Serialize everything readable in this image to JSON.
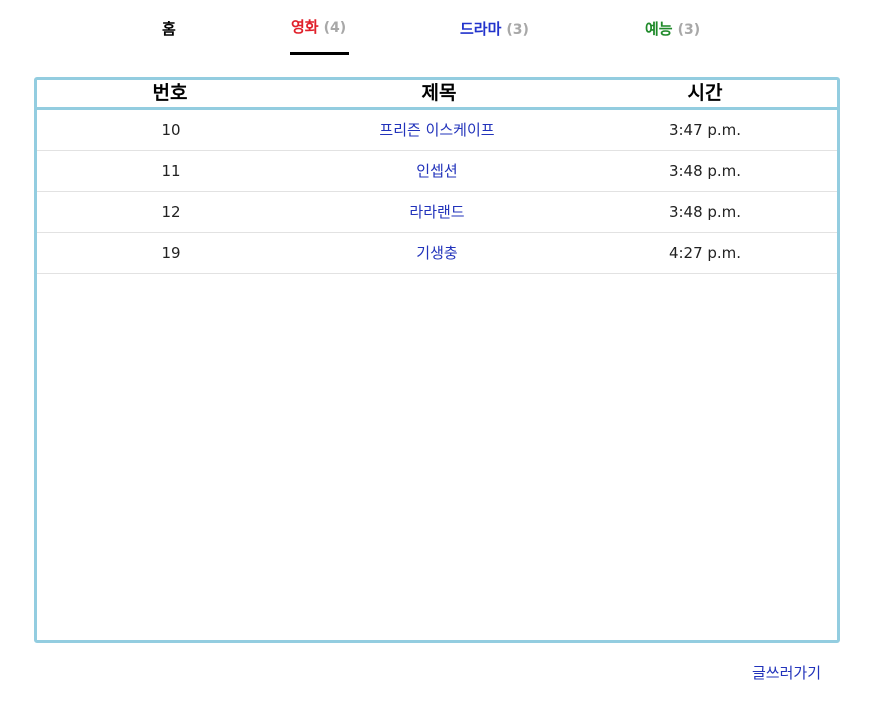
{
  "tabs": {
    "home": {
      "label": "홈"
    },
    "movie": {
      "label": "영화",
      "count": "(4)"
    },
    "drama": {
      "label": "드라마",
      "count": "(3)"
    },
    "variety": {
      "label": "예능",
      "count": "(3)"
    }
  },
  "colors": {
    "movie": "#e0202a",
    "drama": "#2233cc",
    "variety": "#1f8a2a",
    "board_border": "#93cde0",
    "link": "#2233bb"
  },
  "table": {
    "headers": {
      "num": "번호",
      "title": "제목",
      "time": "시간"
    },
    "rows": [
      {
        "num": "10",
        "title": "프리즌 이스케이프",
        "time": "3:47 p.m."
      },
      {
        "num": "11",
        "title": "인셉션",
        "time": "3:48 p.m."
      },
      {
        "num": "12",
        "title": "라라랜드",
        "time": "3:48 p.m."
      },
      {
        "num": "19",
        "title": "기생충",
        "time": "4:27 p.m."
      }
    ]
  },
  "write_link": "글쓰러가기"
}
